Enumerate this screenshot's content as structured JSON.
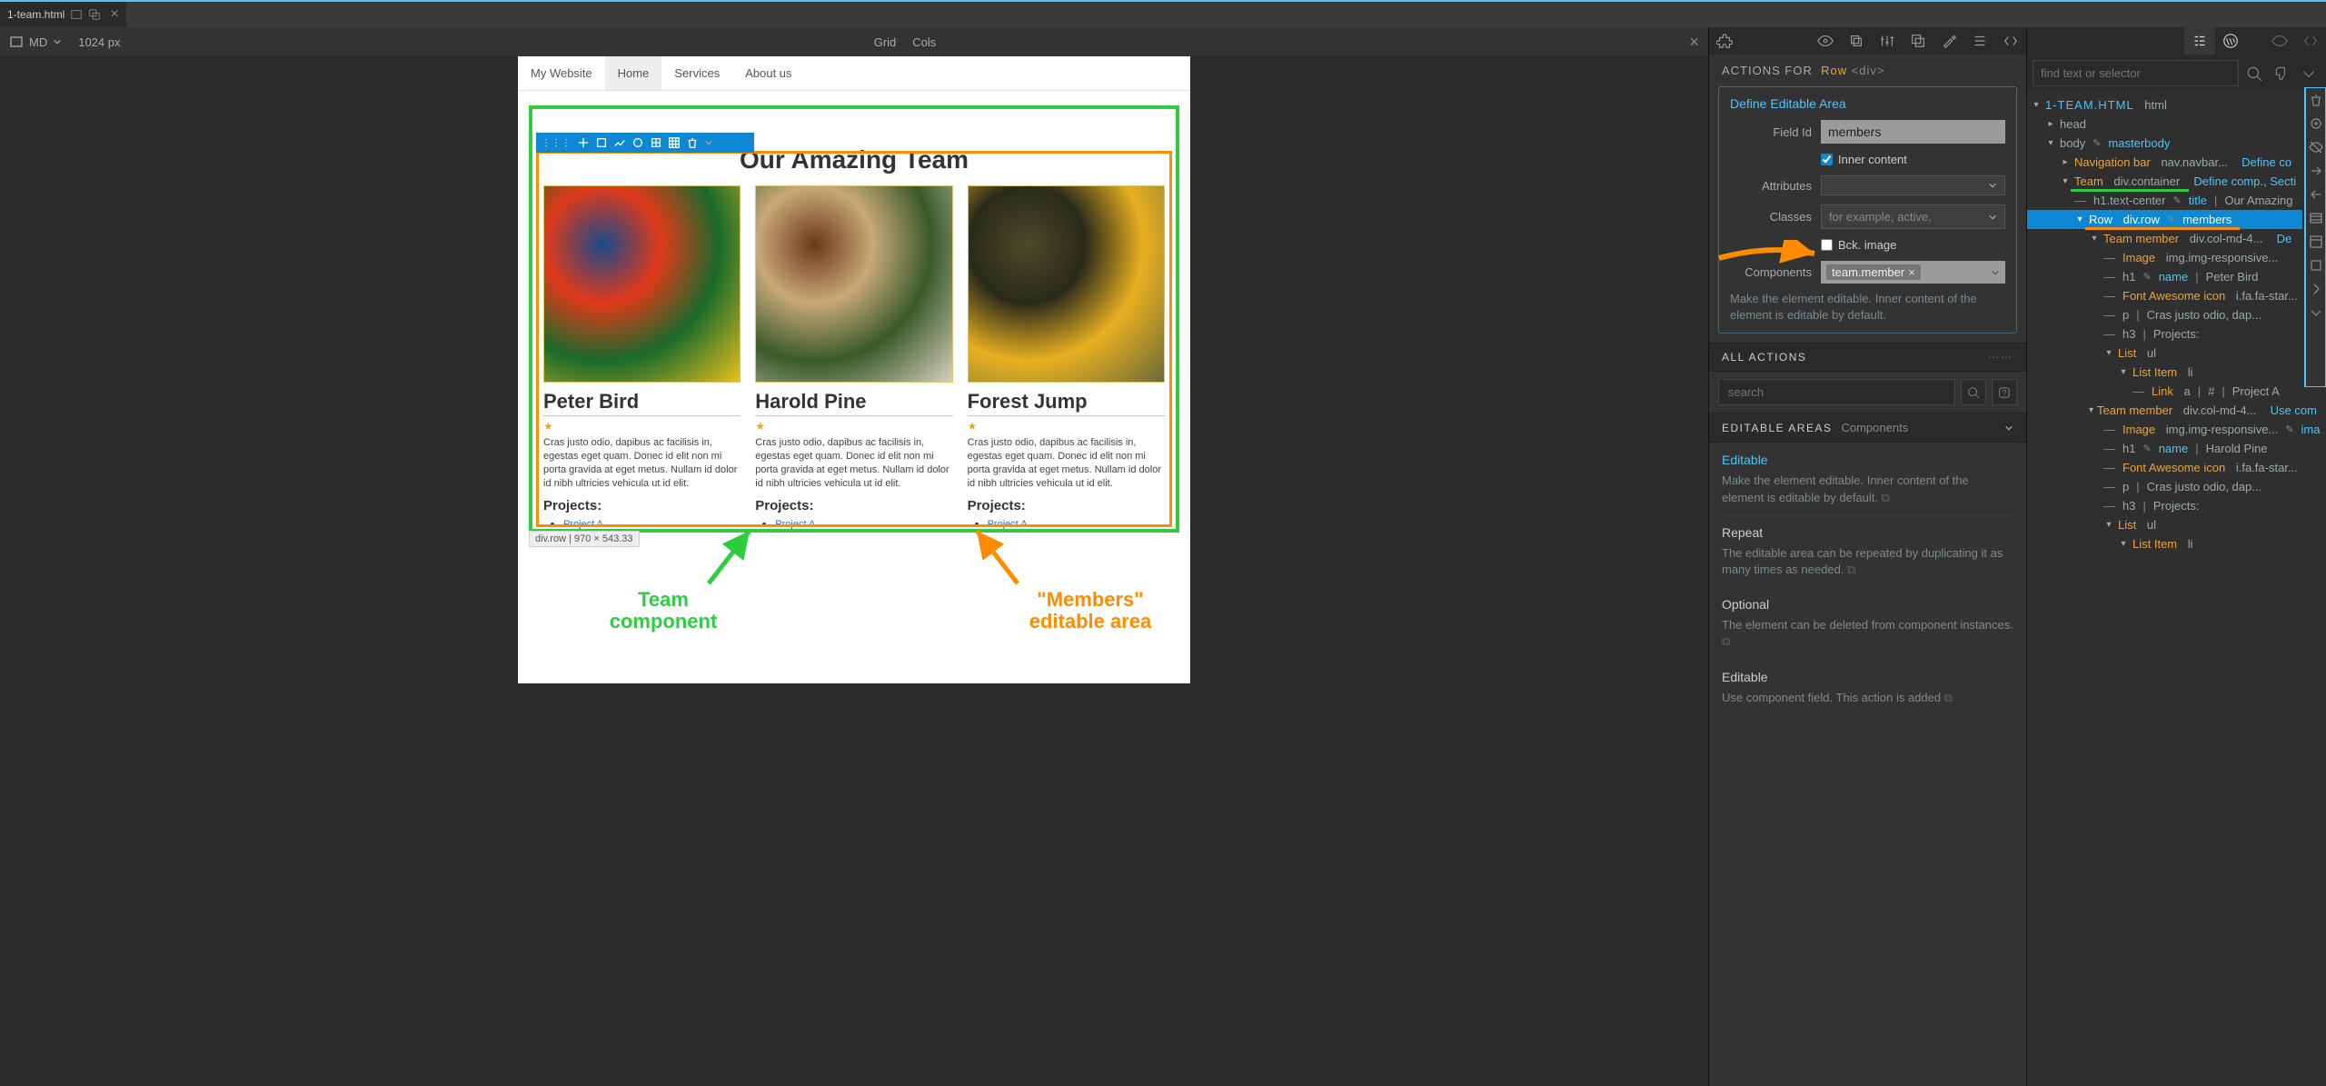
{
  "tab": {
    "filename": "1-team.html"
  },
  "canvas_toolbar": {
    "breakpoint": "MD",
    "width": "1024 px",
    "grid": "Grid",
    "cols": "Cols"
  },
  "site": {
    "brand": "My Website",
    "nav": [
      "Home",
      "Services",
      "About us"
    ],
    "heading": "Our Amazing Team",
    "selection_info": "div.row | 970 × 543.33",
    "members": [
      {
        "name": "Peter Bird",
        "desc": "Cras justo odio, dapibus ac facilisis in, egestas eget quam. Donec id elit non mi porta gravida at eget metus. Nullam id dolor id nibh ultricies vehicula ut id elit.",
        "projects_label": "Projects:",
        "project": "Project A",
        "img_colors": [
          "#1a4a8a",
          "#e03a1a",
          "#1a6a2a",
          "#e8c020"
        ]
      },
      {
        "name": "Harold Pine",
        "desc": "Cras justo odio, dapibus ac facilisis in, egestas eget quam. Donec id elit non mi porta gravida at eget metus. Nullam id dolor id nibh ultricies vehicula ut id elit.",
        "projects_label": "Projects:",
        "project": "Project A",
        "img_colors": [
          "#6a3a1a",
          "#c8a878",
          "#3a5a2a",
          "#d8d0c0"
        ]
      },
      {
        "name": "Forest Jump",
        "desc": "Cras justo odio, dapibus ac facilisis in, egestas eget quam. Donec id elit non mi porta gravida at eget metus. Nullam id dolor id nibh ultricies vehicula ut id elit.",
        "projects_label": "Projects:",
        "project": "Project A",
        "img_colors": [
          "#4a4a2a",
          "#2a2a1a",
          "#e8b020",
          "#6a6a3a"
        ]
      }
    ]
  },
  "annotations": {
    "team_component": "Team\ncomponent",
    "members_area": "\"Members\"\neditable area"
  },
  "mid": {
    "actions_for": "ACTIONS FOR",
    "sel_name": "Row",
    "sel_tag": "<div>",
    "define_link": "Define Editable Area",
    "field_id_label": "Field Id",
    "field_id_value": "members",
    "inner_content": "Inner content",
    "attributes": "Attributes",
    "classes": "Classes",
    "classes_placeholder": "for example, active,",
    "bck_image": "Bck. image",
    "components": "Components",
    "component_tag": "team.member",
    "help1": "Make the element editable. Inner content of the element is editable by default.",
    "all_actions": "ALL ACTIONS",
    "search_placeholder": "search",
    "editable_areas": "EDITABLE AREAS",
    "editable_areas_sub": "Components",
    "ea": [
      {
        "title": "Editable",
        "link": true,
        "desc": "Make the element editable. Inner content of the element is editable by default."
      },
      {
        "title": "Repeat",
        "desc": "The editable area can be repeated by duplicating it as many times as needed."
      },
      {
        "title": "Optional",
        "desc": "The element can be deleted from component instances."
      },
      {
        "title": "Editable",
        "desc": "Use component field. This action is added"
      }
    ]
  },
  "tree": {
    "search_placeholder": "find text or selector",
    "file": "1-TEAM.HTML",
    "file_tag": "html",
    "nodes": {
      "head": "head",
      "body": "body",
      "body_blue": "masterbody",
      "nav": "Navigation bar",
      "nav_gray": "nav.navbar...",
      "nav_blue": "Define co",
      "team": "Team",
      "team_gray": "div.container",
      "team_blue": "Define comp., Secti",
      "h1": "h1.text-center",
      "h1_blue": "title",
      "h1_after": "Our Amazing",
      "row": "Row",
      "row_gray": "div.row",
      "row_blue": "members",
      "tm1": "Team member",
      "tm1_gray": "div.col-md-4...",
      "tm1_blue": "De",
      "img1": "Image",
      "img1_gray": "img.img-responsive...",
      "h1m1": "h1",
      "h1m1_blue": "name",
      "h1m1_after": "Peter Bird",
      "fa1": "Font Awesome icon",
      "fa1_gray": "i.fa.fa-star...",
      "p1": "p",
      "p1_after": "Cras justo odio, dap...",
      "h3_1": "h3",
      "h3_1_after": "Projects:",
      "list1": "List",
      "list1_gray": "ul",
      "li1": "List Item",
      "li1_gray": "li",
      "link1": "Link",
      "link1_gray": "a",
      "link1_sep": "#",
      "link1_after": "Project A",
      "tm2": "Team member",
      "tm2_gray": "div.col-md-4...",
      "tm2_blue": "Use com",
      "img2": "Image",
      "img2_gray": "img.img-responsive...",
      "img2_blue": "ima",
      "h1m2": "h1",
      "h1m2_blue": "name",
      "h1m2_after": "Harold Pine",
      "fa2": "Font Awesome icon",
      "fa2_gray": "i.fa.fa-star...",
      "p2": "p",
      "p2_after": "Cras justo odio, dap...",
      "h3_2": "h3",
      "h3_2_after": "Projects:",
      "list2": "List",
      "list2_gray": "ul",
      "li2": "List Item",
      "li2_gray": "li"
    }
  }
}
